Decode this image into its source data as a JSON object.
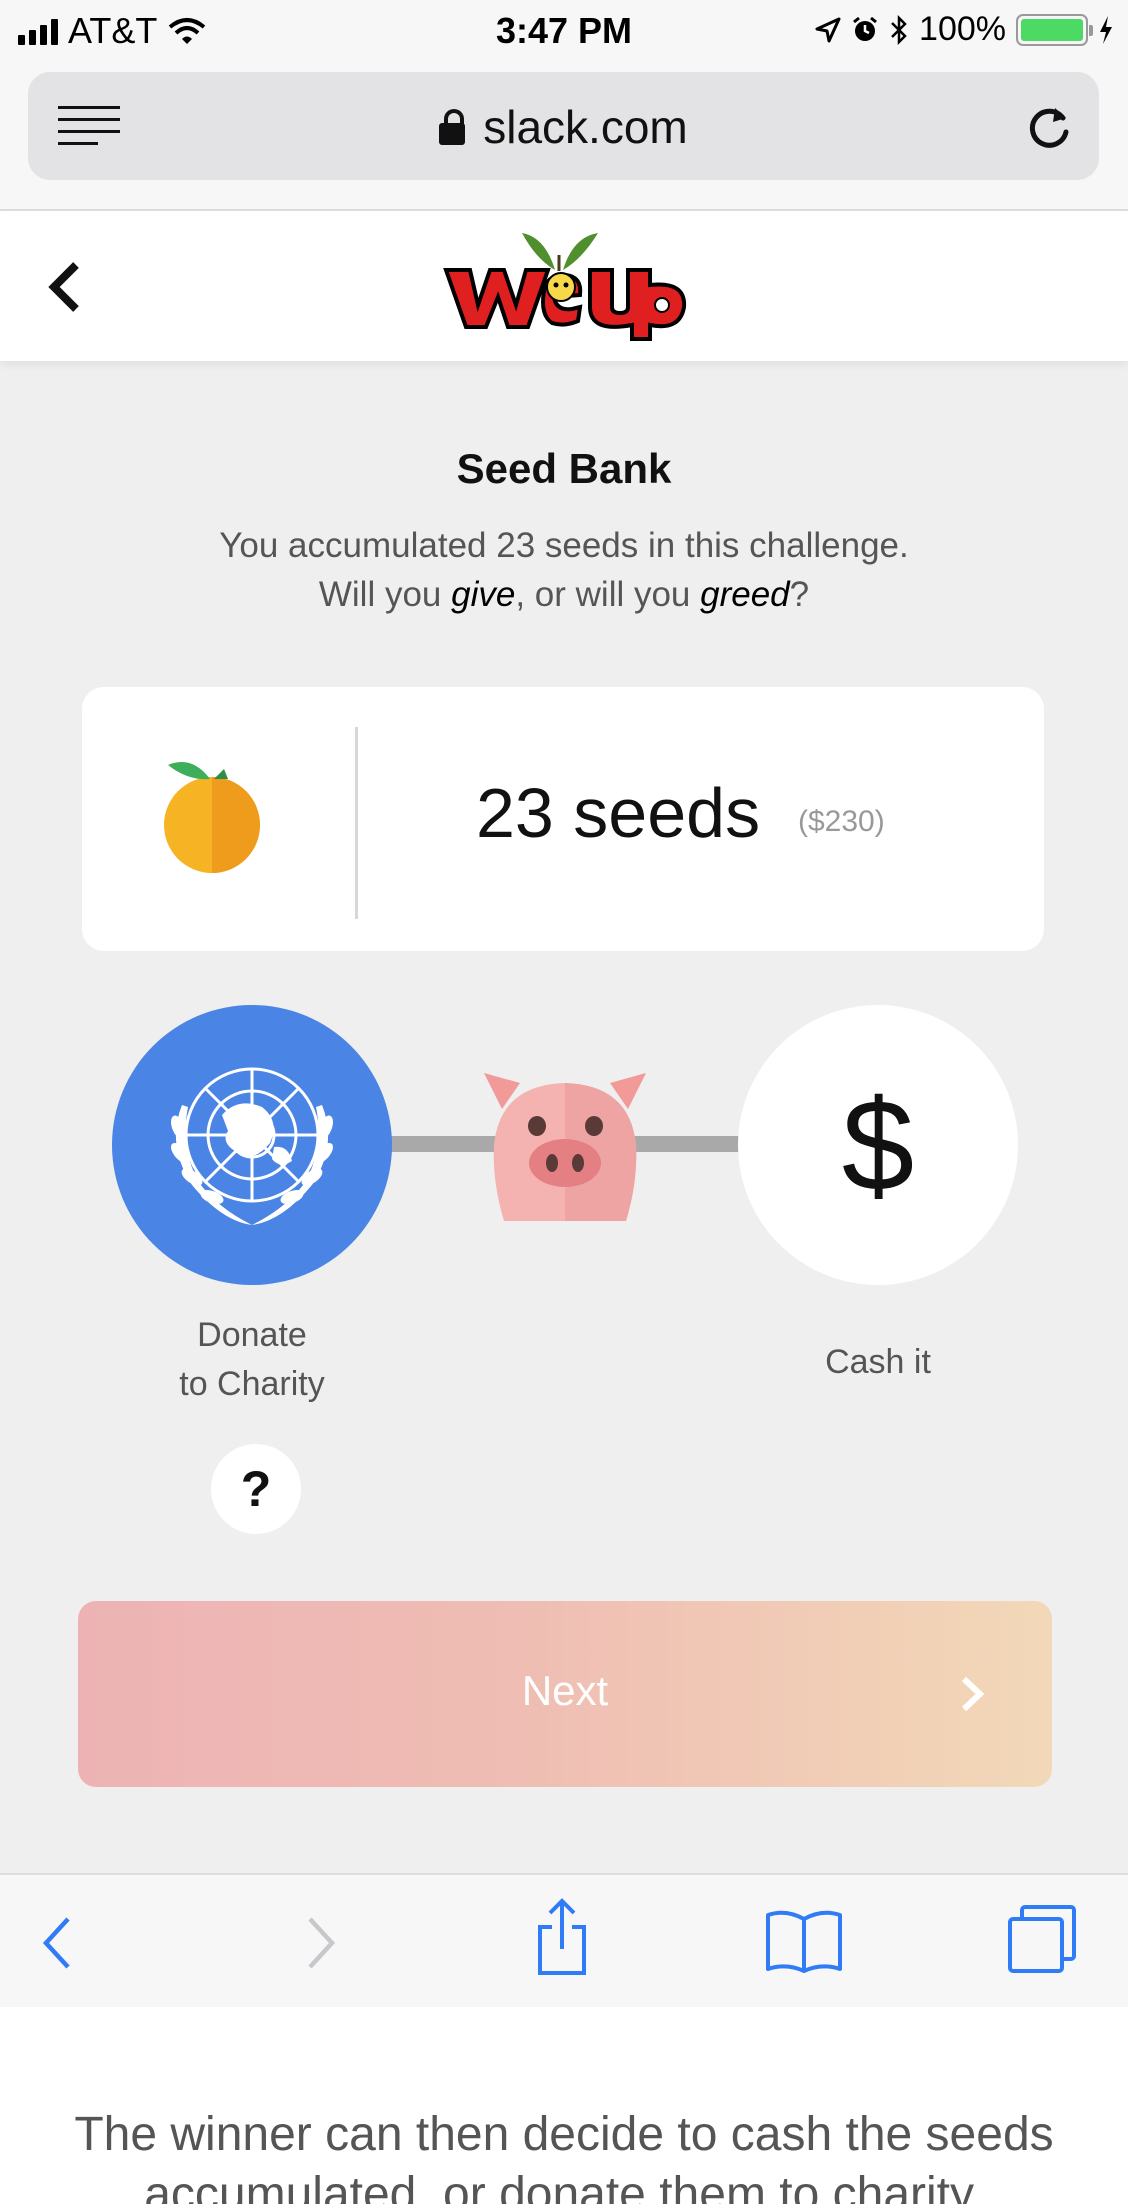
{
  "status_bar": {
    "carrier": "AT&T",
    "time": "3:47 PM",
    "battery": "100%",
    "battery_level": 1.0,
    "icons": [
      "signal-icon",
      "wifi-icon",
      "location-icon",
      "alarm-icon",
      "bluetooth-icon",
      "battery-icon",
      "charging-icon"
    ]
  },
  "browser": {
    "url": "slack.com",
    "icons": [
      "reader-menu-icon",
      "lock-icon",
      "reload-icon"
    ]
  },
  "app_header": {
    "logo_text": "WeUp",
    "icons": [
      "back-chevron-icon",
      "weup-logo"
    ]
  },
  "seed_bank": {
    "title": "Seed Bank",
    "subtitle_line1": "You accumulated 23 seeds in this challenge.",
    "subtitle_line2_prefix": "Will you ",
    "subtitle_give": "give",
    "subtitle_line2_middle": ", or will you ",
    "subtitle_greed": "greed",
    "subtitle_line2_suffix": "?",
    "seed_count": "23 seeds",
    "seed_value": "($230)"
  },
  "choices": {
    "donate_line1": "Donate",
    "donate_line2": "to Charity",
    "cash_symbol": "$",
    "cash_label": "Cash it",
    "help_symbol": "?",
    "charity_color": "#4a84e4"
  },
  "next_button": {
    "label": "Next",
    "gradient_start": "#edb3b4",
    "gradient_end": "#f2d8b8"
  },
  "toolbar": {
    "accent": "#2f7cf6",
    "icons": [
      "back-icon",
      "forward-icon",
      "share-icon",
      "bookmarks-icon",
      "tabs-icon"
    ]
  },
  "caption": {
    "line1": "The winner can then decide to cash the seeds",
    "line2": "accumulated, or donate them to charity."
  }
}
